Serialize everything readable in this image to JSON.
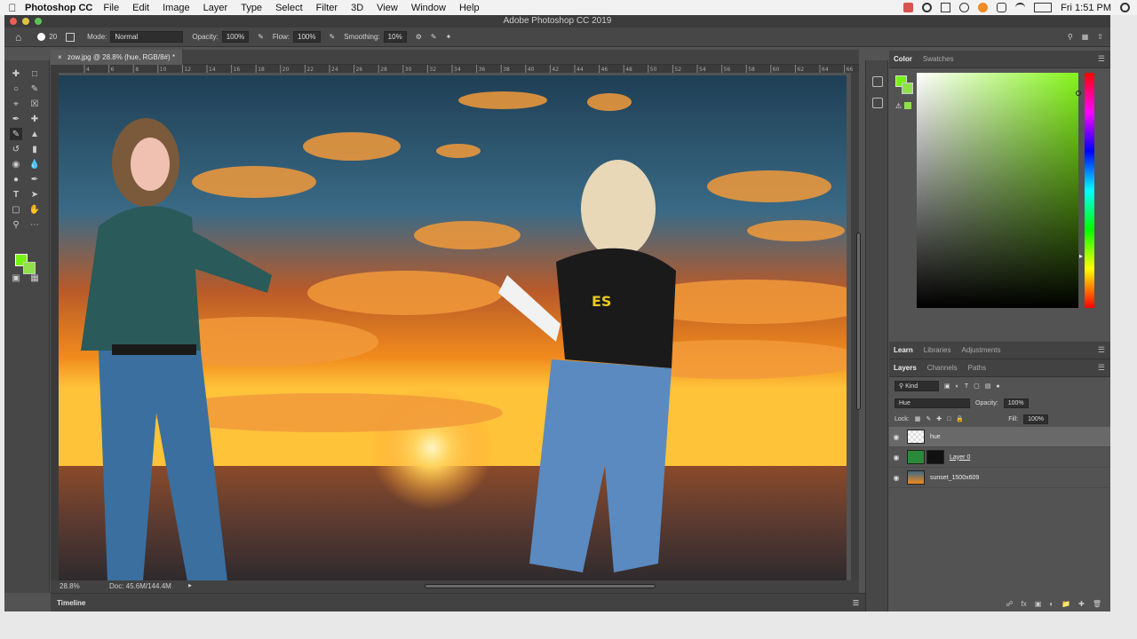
{
  "menubar": {
    "app_name": "Photoshop CC",
    "items": [
      "File",
      "Edit",
      "Image",
      "Layer",
      "Type",
      "Select",
      "Filter",
      "3D",
      "View",
      "Window",
      "Help"
    ],
    "clock": "Fri 1:51 PM"
  },
  "window": {
    "title": "Adobe Photoshop CC 2019"
  },
  "options": {
    "brush_size": "20",
    "mode_label": "Mode:",
    "mode_value": "Normal",
    "opacity_label": "Opacity:",
    "opacity_value": "100%",
    "flow_label": "Flow:",
    "flow_value": "100%",
    "smoothing_label": "Smoothing:",
    "smoothing_value": "10%"
  },
  "document": {
    "tab_title": "zow.jpg @ 28.8% (hue, RGB/8#) *",
    "zoom": "28.8%",
    "doc_info": "Doc: 45.6M/144.4M",
    "ruler_marks": [
      "4",
      "6",
      "8",
      "10",
      "12",
      "14",
      "16",
      "18",
      "20",
      "22",
      "24",
      "26",
      "28",
      "30",
      "32",
      "34",
      "36",
      "38",
      "40",
      "42",
      "44",
      "46",
      "48",
      "50",
      "52",
      "54",
      "56",
      "58",
      "60",
      "62",
      "64",
      "66"
    ]
  },
  "timeline": {
    "label": "Timeline"
  },
  "color_panel": {
    "tabs": [
      "Color",
      "Swatches"
    ]
  },
  "learn_panel": {
    "tabs": [
      "Learn",
      "Libraries",
      "Adjustments"
    ]
  },
  "layers_panel": {
    "tabs": [
      "Layers",
      "Channels",
      "Paths"
    ],
    "kind_label": "Kind",
    "blend_mode": "Hue",
    "opacity_label": "Opacity:",
    "opacity_value": "100%",
    "lock_label": "Lock:",
    "fill_label": "Fill:",
    "fill_value": "100%",
    "layers": [
      {
        "name": "hue"
      },
      {
        "name": "Layer 0"
      },
      {
        "name": "sunset_1500x609"
      }
    ]
  },
  "colors": {
    "foreground": "#78f214",
    "background": "#8ee14a",
    "panel_bg": "#535353"
  }
}
